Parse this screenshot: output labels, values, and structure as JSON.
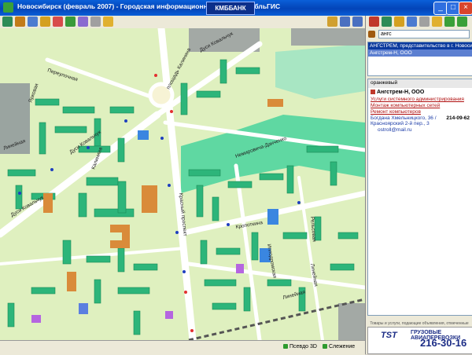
{
  "window": {
    "title": "Новосибирск (февраль 2007) - Городская информационная система ДубльГИС",
    "logo_text": "КМББАНК",
    "buttons": {
      "minimize": "_",
      "maximize": "□",
      "close": "×"
    }
  },
  "colors": {
    "map_bg": "#dff0bf",
    "building": "#2db57a",
    "road": "#ffffff",
    "park": "#5fd8a2",
    "water": "#8fd6ff"
  },
  "map_labels": [
    "Дуси Ковальчук",
    "площадь Калинина",
    "Переулочная",
    "Ярковая",
    "Дуси Ковальчук",
    "Линейная",
    "Калинина",
    "Немировича-Данченко",
    "Красный проспект",
    "Кропоткина",
    "Дуси Ковальчук",
    "Линейная",
    "Ипподромская",
    "Линейная",
    "Рельсовая"
  ],
  "right_panel": {
    "search_value": "ангс",
    "results": [
      "АНГСТРЕМ, представительство в г. Новосибирске",
      "Ангстрем-Н, ООО"
    ],
    "details": {
      "header": "оранжевый",
      "company": "Ангстрем-Н, ООО",
      "services": [
        "Услуги системного администрирования",
        "Монтаж компьютерных сетей",
        "Ремонт компьютеров"
      ],
      "address_1": "Богдана Хмельницкого, 36 /",
      "address_2": "Красноярский 2-й пер., 3",
      "phone": "214-09-62",
      "email": "ostroll@mail.ru"
    },
    "advert_caption": "Товары и услуги, подающие объявления, отмеченные",
    "advert": {
      "logo": "TST",
      "title": "ГРУЗОВЫЕ АВИАПЕРЕВОЗКИ",
      "phone": "216-30-16"
    }
  },
  "statusbar": {
    "pseudo3d": "Псевдо 3D",
    "overlay": "Слежение"
  }
}
